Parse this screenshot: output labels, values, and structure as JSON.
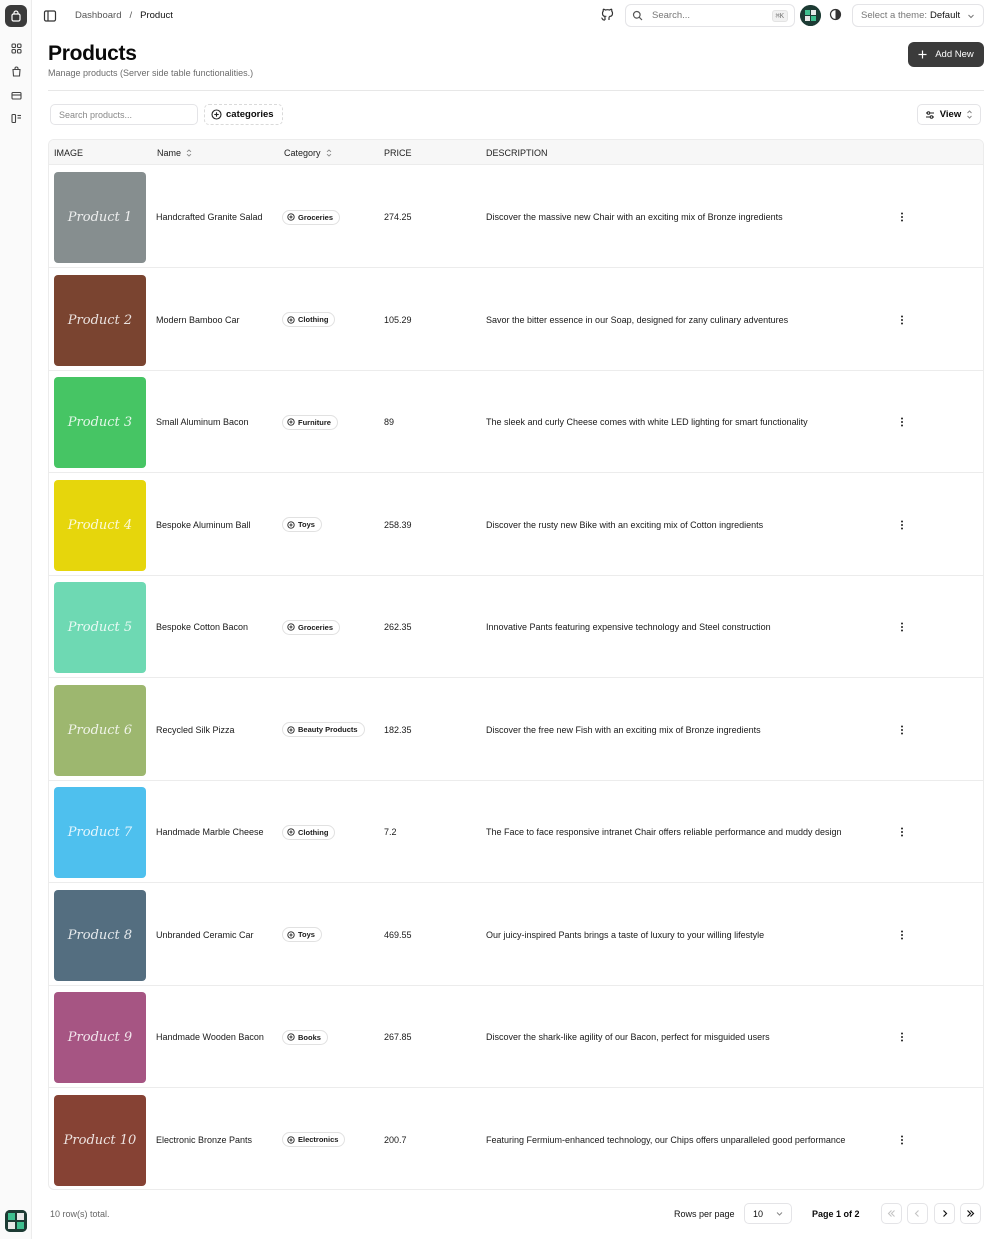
{
  "header": {
    "breadcrumb_root": "Dashboard",
    "breadcrumb_sep": "/",
    "breadcrumb_current": "Product",
    "search_placeholder": "Search...",
    "search_shortcut": "⌘K",
    "theme_label": "Select a theme:",
    "theme_value": "Default"
  },
  "page": {
    "title": "Products",
    "subtitle": "Manage products (Server side table functionalities.)",
    "add_label": "Add New"
  },
  "toolbar": {
    "search_placeholder": "Search products...",
    "categories_label": "categories",
    "view_label": "View"
  },
  "table": {
    "columns": [
      "IMAGE",
      "Name",
      "Category",
      "PRICE",
      "DESCRIPTION"
    ],
    "rows": [
      {
        "image_label": "Product 1",
        "color": "#868e8f",
        "name": "Handcrafted Granite Salad",
        "category": "Groceries",
        "price": "274.25",
        "description": "Discover the massive new Chair with an exciting mix of Bronze ingredients"
      },
      {
        "image_label": "Product 2",
        "color": "#7a4430",
        "name": "Modern Bamboo Car",
        "category": "Clothing",
        "price": "105.29",
        "description": "Savor the bitter essence in our Soap, designed for zany culinary adventures"
      },
      {
        "image_label": "Product 3",
        "color": "#46c564",
        "name": "Small Aluminum Bacon",
        "category": "Furniture",
        "price": "89",
        "description": "The sleek and curly Cheese comes with white LED lighting for smart functionality"
      },
      {
        "image_label": "Product 4",
        "color": "#e6d60c",
        "name": "Bespoke Aluminum Ball",
        "category": "Toys",
        "price": "258.39",
        "description": "Discover the rusty new Bike with an exciting mix of Cotton ingredients"
      },
      {
        "image_label": "Product 5",
        "color": "#6ed9b3",
        "name": "Bespoke Cotton Bacon",
        "category": "Groceries",
        "price": "262.35",
        "description": "Innovative Pants featuring expensive technology and Steel construction"
      },
      {
        "image_label": "Product 6",
        "color": "#9db76f",
        "name": "Recycled Silk Pizza",
        "category": "Beauty Products",
        "price": "182.35",
        "description": "Discover the free new Fish with an exciting mix of Bronze ingredients"
      },
      {
        "image_label": "Product 7",
        "color": "#4ec0ee",
        "name": "Handmade Marble Cheese",
        "category": "Clothing",
        "price": "7.2",
        "description": "The Face to face responsive intranet Chair offers reliable performance and muddy design"
      },
      {
        "image_label": "Product 8",
        "color": "#546e80",
        "name": "Unbranded Ceramic Car",
        "category": "Toys",
        "price": "469.55",
        "description": "Our juicy-inspired Pants brings a taste of luxury to your willing lifestyle"
      },
      {
        "image_label": "Product 9",
        "color": "#a65583",
        "name": "Handmade Wooden Bacon",
        "category": "Books",
        "price": "267.85",
        "description": "Discover the shark-like agility of our Bacon, perfect for misguided users"
      },
      {
        "image_label": "Product 10",
        "color": "#864234",
        "name": "Electronic Bronze Pants",
        "category": "Electronics",
        "price": "200.7",
        "description": "Featuring Fermium-enhanced technology, our Chips offers unparalleled good performance"
      }
    ]
  },
  "footer": {
    "row_total": "10 row(s) total.",
    "rows_per_page_label": "Rows per page",
    "rows_per_page_value": "10",
    "page_info": "Page 1 of 2"
  }
}
